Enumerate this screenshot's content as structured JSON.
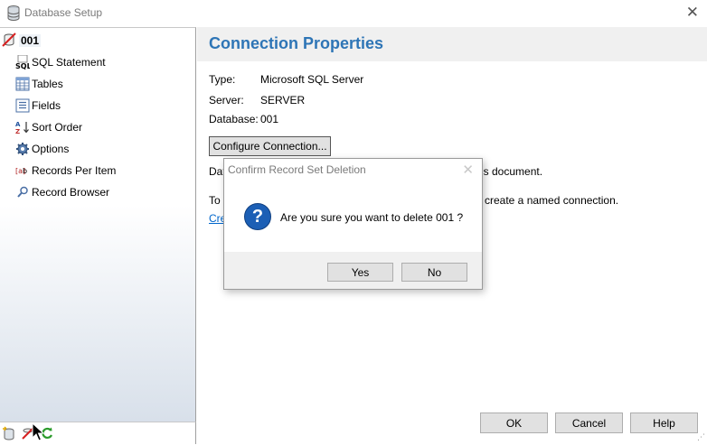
{
  "window": {
    "title": "Database Setup",
    "icons": {
      "app": "database-icon",
      "close": "close-icon"
    }
  },
  "sidebar": {
    "root": {
      "label": "001",
      "icon": "recordset-icon"
    },
    "items": [
      {
        "label": "SQL Statement",
        "icon": "sql-icon"
      },
      {
        "label": "Tables",
        "icon": "table-icon"
      },
      {
        "label": "Fields",
        "icon": "fields-icon"
      },
      {
        "label": "Sort Order",
        "icon": "sort-az-icon"
      },
      {
        "label": "Options",
        "icon": "gear-icon"
      },
      {
        "label": "Records Per Item",
        "icon": "records-icon"
      },
      {
        "label": "Record Browser",
        "icon": "search-icon"
      }
    ],
    "bottom_icons": [
      "add-database-icon",
      "delete-icon",
      "refresh-icon"
    ]
  },
  "main": {
    "heading": "Connection Properties",
    "type_label": "Type:",
    "type_value": "Microsoft SQL Server",
    "server_label": "Server:",
    "server_value": "SERVER",
    "database_label": "Database:",
    "database_value": "001",
    "configure_button": "Configure Connection...",
    "line1_left": "Dat",
    "line1_right": "is document.",
    "line2_left": "To",
    "line2_right": "create a named connection.",
    "link_partial": "Cre"
  },
  "dialog": {
    "title": "Confirm Record Set Deletion",
    "message": "Are you sure you want to delete 001 ?",
    "icon": "question-icon",
    "yes_label": "Yes",
    "no_label": "No"
  },
  "footer": {
    "ok_label": "OK",
    "cancel_label": "Cancel",
    "help_label": "Help"
  },
  "colors": {
    "heading": "#2e75b6",
    "link": "#0066cc",
    "dialog_icon": "#1c5fb5"
  }
}
